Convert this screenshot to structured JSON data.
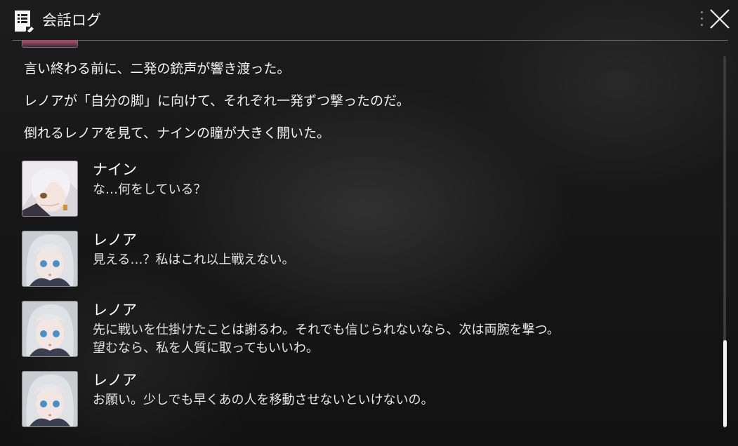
{
  "header": {
    "title": "会話ログ",
    "icon": "log-icon",
    "menu_icon": "more-vertical-icon",
    "close_icon": "close-icon"
  },
  "narration": [
    "言い終わる前に、二発の銃声が響き渡った。",
    "レノアが「自分の脚」に向けて、それぞれ一発ずつ撃ったのだ。",
    "倒れるレノアを見て、ナインの瞳が大きく開いた。"
  ],
  "entries": [
    {
      "speaker": "ナイン",
      "lines": [
        "な…何をしている？"
      ],
      "avatar": "nine-portrait"
    },
    {
      "speaker": "レノア",
      "lines": [
        "見える…？私はこれ以上戦えない。"
      ],
      "avatar": "lenoa-portrait"
    },
    {
      "speaker": "レノア",
      "lines": [
        "先に戦いを仕掛けたことは謝るわ。それでも信じられないなら、次は両腕を撃つ。",
        "望むなら、私を人質に取ってもいいわ。"
      ],
      "avatar": "lenoa-portrait"
    },
    {
      "speaker": "レノア",
      "lines": [
        "お願い。少しでも早くあの人を移動させないといけないの。"
      ],
      "avatar": "lenoa-portrait"
    }
  ],
  "scroll": {
    "position": 0.95
  }
}
